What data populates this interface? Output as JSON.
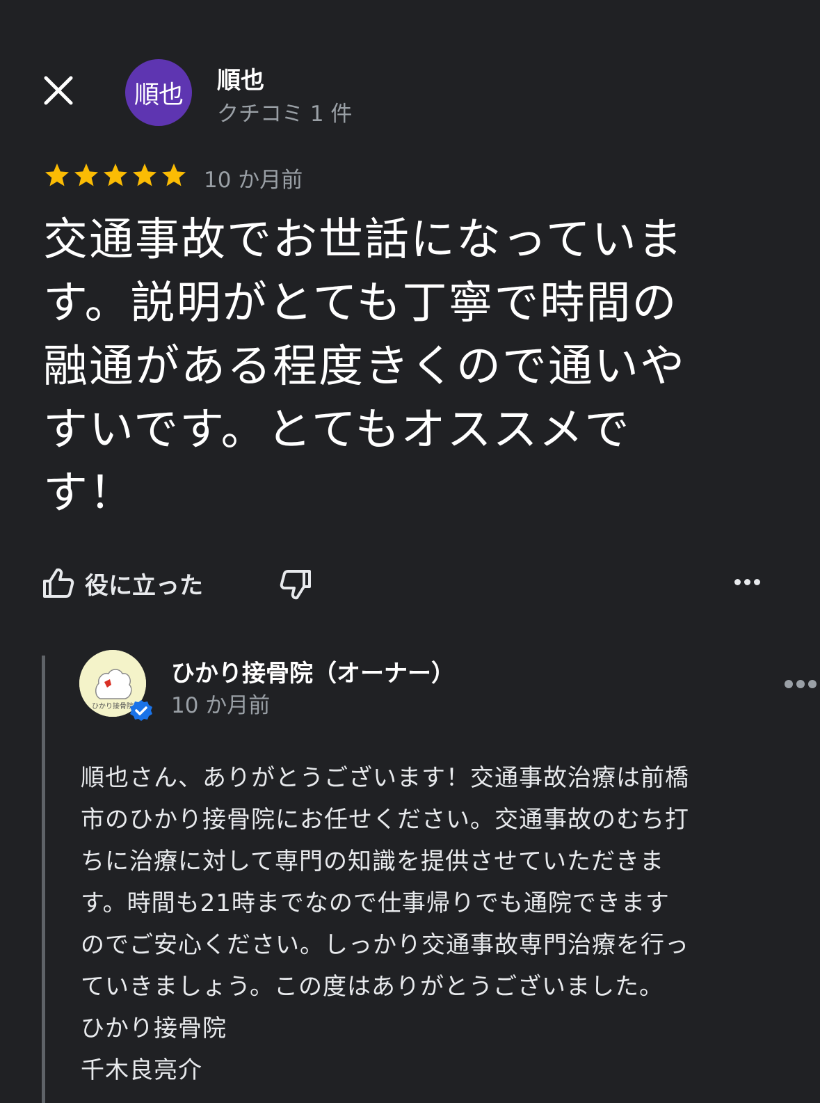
{
  "header": {
    "reviewer_name": "順也",
    "avatar_text": "順也",
    "reviewer_meta": "クチコミ 1 件"
  },
  "review": {
    "rating": 5,
    "max_rating": 5,
    "date": "10 か月前",
    "text": "交通事故でお世話になっていま\nす。説明がとても丁寧で時間の\n融通がある程度きくので通いや\nすいです。とてもオススメで\nす！"
  },
  "actions": {
    "helpful_label": "役に立った"
  },
  "owner_reply": {
    "name": "ひかり接骨院（オーナー）",
    "date": "10 か月前",
    "logo_text": "ひかり接骨院",
    "text": "順也さん、ありがとうございます！交通事故治療は前橋\n市のひかり接骨院にお任せください。交通事故のむち打\nちに治療に対して専門の知識を提供させていただきま\nす。時間も21時までなので仕事帰りでも通院できます\nのでご安心ください。しっかり交通事故専門治療を行っ\nていきましょう。この度はありがとうございました。\nひかり接骨院\n千木良亮介"
  },
  "colors": {
    "background": "#202124",
    "star": "#fbbc04",
    "avatar": "#5e35b1",
    "verified": "#1a73e8"
  }
}
